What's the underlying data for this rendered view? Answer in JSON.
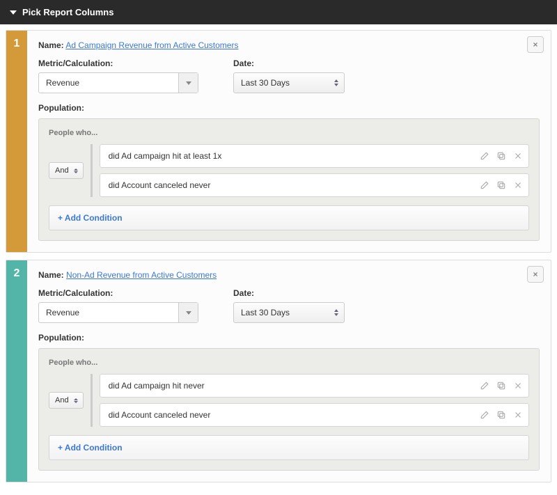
{
  "header": {
    "title": "Pick Report Columns"
  },
  "labels": {
    "name": "Name:",
    "metric": "Metric/Calculation:",
    "date": "Date:",
    "population": "Population:",
    "people_who": "People who...",
    "and": "And",
    "add_condition": "+  Add Condition"
  },
  "columns": [
    {
      "number": "1",
      "accent": "orange",
      "name": "Ad Campaign Revenue from Active Customers",
      "metric": "Revenue",
      "date": "Last 30 Days",
      "conditions": [
        "did Ad campaign hit at least 1x",
        "did Account canceled never"
      ]
    },
    {
      "number": "2",
      "accent": "teal",
      "name": "Non-Ad Revenue from Active Customers",
      "metric": "Revenue",
      "date": "Last 30 Days",
      "conditions": [
        "did Ad campaign hit never",
        "did Account canceled never"
      ]
    }
  ]
}
